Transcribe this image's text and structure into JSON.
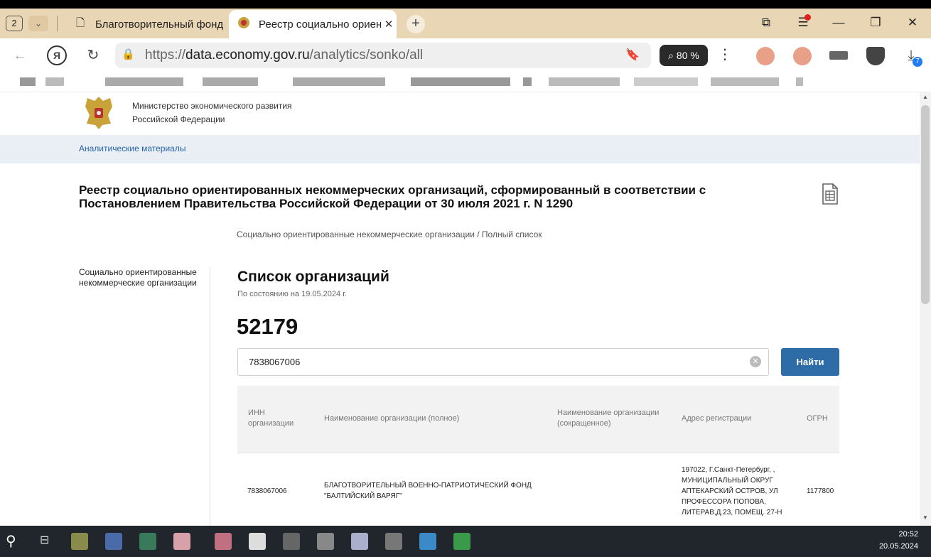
{
  "browser": {
    "tab_count": "2",
    "tabs": [
      {
        "title": "Благотворительный фонд",
        "active": false
      },
      {
        "title": "Реестр социально ориентированных",
        "active": true
      }
    ],
    "url_prefix": "https://",
    "url_domain": "data.economy.gov.ru",
    "url_path": "/analytics/sonko/all",
    "zoom": "80 %",
    "download_badge": "7"
  },
  "site": {
    "ministry_line1": "Министерство экономического развития",
    "ministry_line2": "Российской Федерации",
    "subnav_link": "Аналитические материалы",
    "page_title": "Реестр социально ориентированных некоммерческих организаций, сформированный в соответствии с Постановлением Правительства Российской Федерации от 30 июля 2021 г. N 1290",
    "breadcrumb": "Социально ориентированные некоммерческие организации  / Полный список",
    "left_menu_item": "Социально ориентированные некоммерческие организации"
  },
  "list": {
    "title": "Список организаций",
    "as_of": "По состоянию на 19.05.2024 г.",
    "total": "52179",
    "search_value": "7838067006",
    "find_label": "Найти"
  },
  "table": {
    "headers": {
      "inn": "ИНН организации",
      "full_name": "Наименование организации (полное)",
      "short_name": "Наименование организации (сокращенное)",
      "address": "Адрес регистрации",
      "ogrn": "ОГРН"
    },
    "rows": [
      {
        "inn": "7838067006",
        "full_name": "БЛАГОТВОРИТЕЛЬНЫЙ ВОЕННО-ПАТРИОТИЧЕСКИЙ ФОНД \"БАЛТИЙСКИЙ ВАРЯГ\"",
        "short_name": "",
        "address": "197022, Г.Санкт-Петербург, , МУНИЦИПАЛЬНЫЙ ОКРУГ АПТЕКАРСКИЙ ОСТРОВ, УЛ ПРОФЕССОРА ПОПОВА, ЛИТЕРАВ,Д.23, ПОМЕЩ. 27-Н",
        "ogrn": "1177800"
      }
    ]
  },
  "taskbar": {
    "time": "20:52",
    "date": "20.05.2024"
  },
  "colors": {
    "tabstrip": "#e9d6b4",
    "subnav_bg": "#e9eff5",
    "link": "#2863a6",
    "find_button": "#2e6ca8",
    "taskbar": "#20262c"
  }
}
